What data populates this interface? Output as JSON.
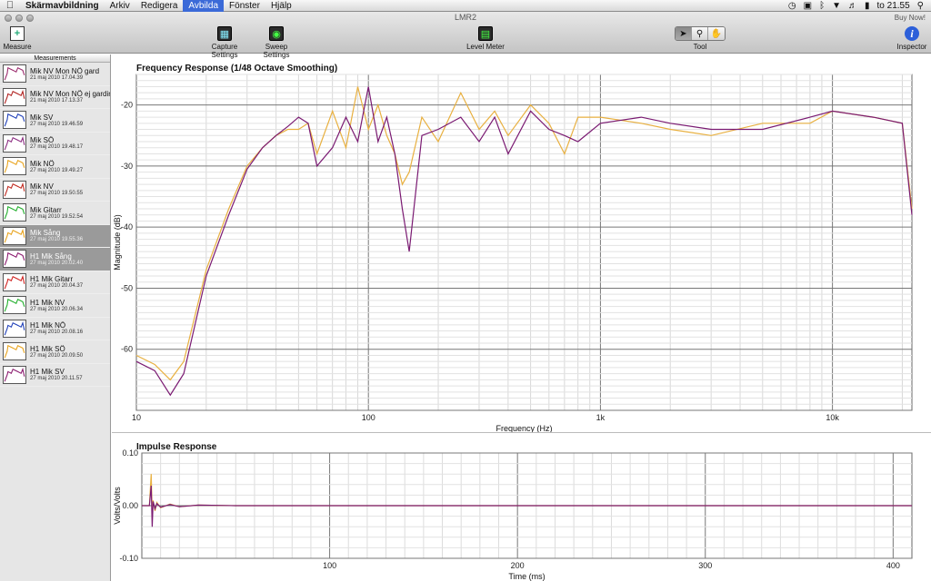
{
  "menubar": {
    "app_name": "Skärmavbildning",
    "items": [
      "Arkiv",
      "Redigera",
      "Avbilda",
      "Fönster",
      "Hjälp"
    ],
    "active_item": "Avbilda",
    "clock": "to 21.55"
  },
  "window": {
    "title": "LMR2",
    "buy_now": "Buy Now!"
  },
  "toolbar": {
    "measure": "Measure",
    "capture_settings": "Capture Settings",
    "sweep_settings": "Sweep Settings",
    "level_meter": "Level Meter",
    "tool": "Tool",
    "inspector": "Inspector"
  },
  "sidebar": {
    "header": "Measurements",
    "items": [
      {
        "name": "Mik NV Mon NÖ gard",
        "date": "21 maj 2010 17.04.39",
        "color": "#9b2a6d",
        "selected": false
      },
      {
        "name": "Mik NV Mon NÖ ej gardin",
        "date": "21 maj 2010 17.13.37",
        "color": "#b0201e",
        "selected": false
      },
      {
        "name": "Mik SV",
        "date": "27 maj 2010 19.46.59",
        "color": "#1f3fb8",
        "selected": false
      },
      {
        "name": "Mik SÖ",
        "date": "27 maj 2010 19.48.17",
        "color": "#8a2a80",
        "selected": false
      },
      {
        "name": "Mik NÖ",
        "date": "27 maj 2010 19.49.27",
        "color": "#e8a21a",
        "selected": false
      },
      {
        "name": "Mik NV",
        "date": "27 maj 2010 19.50.55",
        "color": "#c0281e",
        "selected": false
      },
      {
        "name": "Mik Gitarr",
        "date": "27 maj 2010 19.52.54",
        "color": "#1fae2a",
        "selected": false
      },
      {
        "name": "Mik Sång",
        "date": "27 maj 2010 19.55.36",
        "color": "#e8a21a",
        "selected": true
      },
      {
        "name": "H1 Mik Sång",
        "date": "27 maj 2010 20.02.40",
        "color": "#8a1a6e",
        "selected": true
      },
      {
        "name": "H1 Mik Gitarr",
        "date": "27 maj 2010 20.04.37",
        "color": "#d0201e",
        "selected": false
      },
      {
        "name": "H1 Mik NV",
        "date": "27 maj 2010 20.06.34",
        "color": "#1fae2a",
        "selected": false
      },
      {
        "name": "H1 Mik NÖ",
        "date": "27 maj 2010 20.08.16",
        "color": "#1f3fb8",
        "selected": false
      },
      {
        "name": "H1 Mik SÖ",
        "date": "27 maj 2010 20.09.50",
        "color": "#e8a21a",
        "selected": false
      },
      {
        "name": "H1 Mik SV",
        "date": "27 maj 2010 20.11.57",
        "color": "#8a1a6e",
        "selected": false
      }
    ]
  },
  "chart_data": [
    {
      "type": "line",
      "title": "Frequency Response (1/48 Octave Smoothing)",
      "xlabel": "Frequency (Hz)",
      "ylabel": "Magnitude (dB)",
      "x_scale": "log",
      "xlim": [
        10,
        22000
      ],
      "ylim": [
        -70,
        -15
      ],
      "x_ticks": [
        {
          "v": 10,
          "label": "10"
        },
        {
          "v": 100,
          "label": "100"
        },
        {
          "v": 1000,
          "label": "1k"
        },
        {
          "v": 10000,
          "label": "10k"
        }
      ],
      "y_ticks": [
        {
          "v": -20,
          "label": "-20"
        },
        {
          "v": -30,
          "label": "-30"
        },
        {
          "v": -40,
          "label": "-40"
        },
        {
          "v": -50,
          "label": "-50"
        },
        {
          "v": -60,
          "label": "-60"
        }
      ],
      "grid": true,
      "series": [
        {
          "color": "#e8b040",
          "x": [
            10,
            12,
            14,
            16,
            20,
            25,
            30,
            35,
            40,
            45,
            50,
            55,
            60,
            70,
            80,
            90,
            100,
            110,
            120,
            130,
            140,
            150,
            170,
            200,
            250,
            300,
            350,
            400,
            500,
            600,
            700,
            800,
            1000,
            1500,
            2000,
            3000,
            5000,
            8000,
            10000,
            15000,
            20000,
            22000
          ],
          "y": [
            -61,
            -62.5,
            -65,
            -62,
            -47,
            -37,
            -30,
            -27,
            -25,
            -24,
            -24,
            -23,
            -28,
            -21,
            -27,
            -17,
            -24,
            -20,
            -25,
            -28,
            -33,
            -31,
            -22,
            -26,
            -18,
            -24,
            -21,
            -25,
            -20,
            -23,
            -28,
            -22,
            -22,
            -23,
            -24,
            -25,
            -23,
            -23,
            -21,
            -22,
            -23,
            -37
          ]
        },
        {
          "color": "#7a1a72",
          "x": [
            10,
            12,
            14,
            16,
            20,
            25,
            30,
            35,
            40,
            45,
            50,
            55,
            60,
            70,
            80,
            90,
            100,
            110,
            120,
            130,
            140,
            150,
            170,
            200,
            250,
            300,
            350,
            400,
            500,
            600,
            700,
            800,
            1000,
            1500,
            2000,
            3000,
            5000,
            8000,
            10000,
            15000,
            20000,
            22000
          ],
          "y": [
            -62,
            -63.5,
            -67.5,
            -64,
            -48,
            -38,
            -30.5,
            -27,
            -25,
            -23.5,
            -22,
            -23,
            -30,
            -27,
            -22,
            -26,
            -17,
            -26,
            -22,
            -28,
            -37,
            -44,
            -25,
            -24,
            -22,
            -26,
            -22,
            -28,
            -21,
            -24,
            -25,
            -26,
            -23,
            -22,
            -23,
            -24,
            -24,
            -22,
            -21,
            -22,
            -23,
            -38
          ]
        }
      ]
    },
    {
      "type": "line",
      "title": "Impulse Response",
      "xlabel": "Time (ms)",
      "ylabel": "Volts/Volts",
      "xlim": [
        0,
        410
      ],
      "ylim": [
        -0.1,
        0.1
      ],
      "x_ticks": [
        {
          "v": 100,
          "label": "100"
        },
        {
          "v": 200,
          "label": "200"
        },
        {
          "v": 300,
          "label": "300"
        },
        {
          "v": 400,
          "label": "400"
        }
      ],
      "y_ticks": [
        {
          "v": 0.1,
          "label": "0.10"
        },
        {
          "v": 0.0,
          "label": "0.00"
        },
        {
          "v": -0.1,
          "label": "-0.10"
        }
      ],
      "grid": true,
      "series": [
        {
          "color": "#e8b040",
          "x": [
            0,
            4,
            5,
            5.5,
            6,
            7,
            8,
            10,
            15,
            20,
            30,
            50,
            80,
            410
          ],
          "y": [
            0,
            0,
            0.06,
            -0.015,
            0.01,
            -0.01,
            0.006,
            -0.004,
            0.003,
            -0.002,
            0.001,
            0,
            0,
            0
          ]
        },
        {
          "color": "#7a1a72",
          "x": [
            0,
            4,
            5,
            5.5,
            6,
            7,
            8,
            10,
            15,
            20,
            30,
            50,
            80,
            410
          ],
          "y": [
            0,
            0,
            0.038,
            -0.04,
            0.008,
            -0.006,
            0.004,
            -0.003,
            0.002,
            -0.002,
            0.001,
            0,
            0,
            0
          ]
        }
      ]
    }
  ]
}
